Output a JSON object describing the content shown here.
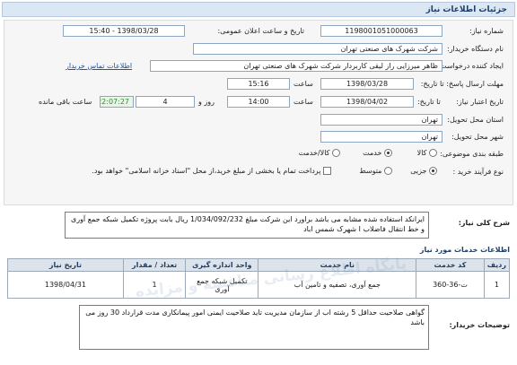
{
  "page_title": "جزئیات اطلاعات نیاز",
  "fields": {
    "need_number_label": "شماره نیاز:",
    "need_number": "1198001051000063",
    "announce_label": "تاریخ و ساعت اعلان عمومی:",
    "announce_value": "1398/03/28 - 15:40",
    "buyer_label": "نام دستگاه خریدار:",
    "buyer_value": "شرکت شهرک های صنعتی تهران",
    "creator_label": "ایجاد کننده درخواست:",
    "creator_value": "ظاهر  میرزایی راز لیقی کاربردار  شرکت شهرک های صنعتی تهران",
    "contact_link": "اطلاعات تماس خریدار",
    "reply_deadline_label": "مهلت ارسال پاسخ: تا تاریخ:",
    "reply_date": "1398/03/28",
    "time_label": "ساعت",
    "reply_time": "15:16",
    "validity_label": "تاریخ اعتبار نیاز:",
    "validity_prefix": "تا تاریخ:",
    "validity_date": "1398/04/02",
    "validity_time_label": "ساعت",
    "validity_time": "14:00",
    "days_value": "4",
    "days_label": "روز و",
    "remaining_time": "22:07:27",
    "remaining_label": "ساعت باقی مانده",
    "province_label": "استان محل تحویل:",
    "province_value": "تهران",
    "city_label": "شهر محل تحویل:",
    "city_value": "تهران",
    "category_label": "طبقه بندی موضوعی:",
    "category_options": [
      "کالا",
      "خدمت",
      "کالا/خدمت"
    ],
    "process_label": "نوع فرآیند خرید :",
    "process_options": [
      "جزیی",
      "متوسط"
    ],
    "payment_text": "پرداخت تمام یا بخشی از مبلغ خرید،از محل \"اسناد خزانه اسلامی\" خواهد بود."
  },
  "summary": {
    "label": "شرح کلی نیاز:",
    "text": "ایرانکد استفاده شده مشابه می باشد براورد این شرکت مبلغ 1/034/092/232 ریال بابت پروژه تکمیل شبکه جمع آوری و خط انتقال فاضلاب ا شهرک شمس اباد"
  },
  "services": {
    "title": "اطلاعات خدمات مورد نیاز",
    "headers": [
      "ردیف",
      "کد خدمت",
      "نام خدمت",
      "واحد اندازه گیری",
      "تعداد / مقدار",
      "تاریخ نیاز"
    ],
    "rows": [
      [
        "1",
        "ت-36-360",
        "جمع آوری، تصفیه و تامین آب",
        "تکمیل شبکه جمع آوری",
        "1",
        "1398/04/31"
      ]
    ]
  },
  "buyer_notes": {
    "label": "توضیحات خریدار:",
    "text": "گواهی صلاحیت حداقل 5 رشته اب  از سازمان مدیریت  تاید صلاحیت ایمنی امور پیمانکاری  مدت قرارداد 30 روز می باشد"
  },
  "watermark": "پایگاه اطلاع رسانی مناقصه و مزایده"
}
